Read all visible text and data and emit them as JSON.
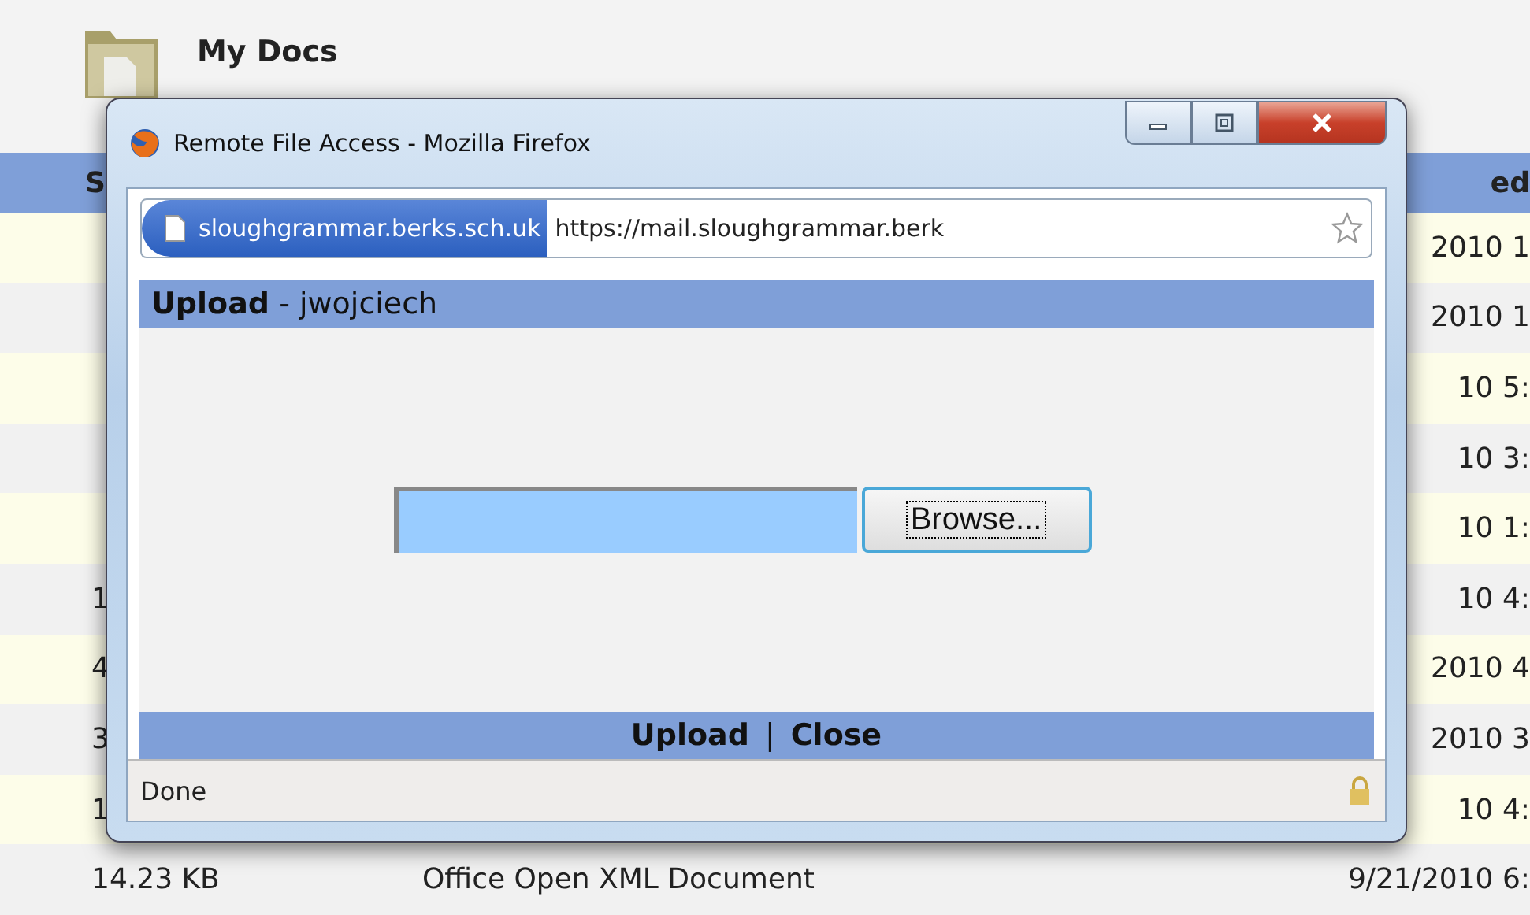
{
  "page": {
    "title": "My Docs"
  },
  "table": {
    "header": {
      "column_1": "S",
      "column_3": "ed"
    },
    "rows": [
      {
        "column_3": "2010 1"
      },
      {
        "column_3": "2010 1"
      },
      {
        "column_3": "10 5:"
      },
      {
        "column_3": "10 3:"
      },
      {
        "column_3": "10 1:"
      },
      {
        "column_1": "1",
        "column_3": "10 4:"
      },
      {
        "column_1": "4",
        "column_3": "2010 4"
      },
      {
        "column_1": "3",
        "column_3": "2010 3"
      },
      {
        "column_1": "1",
        "column_3": "10 4:"
      },
      {
        "column_1": "14.23 KB",
        "column_2": "Office Open XML Document",
        "column_3": "9/21/2010 6:"
      }
    ]
  },
  "browser": {
    "title": "Remote File Access - Mozilla Firefox",
    "site_identity": "sloughgrammar.berks.sch.uk",
    "url": "https://mail.sloughgrammar.berk",
    "status": "Done"
  },
  "dialog": {
    "heading": "**Upload** - jwojciech",
    "browse_button": "Browse...",
    "separator": "|",
    "actions": [
      {
        "label": "Upload"
      },
      {
        "label": "Close"
      }
    ]
  }
}
